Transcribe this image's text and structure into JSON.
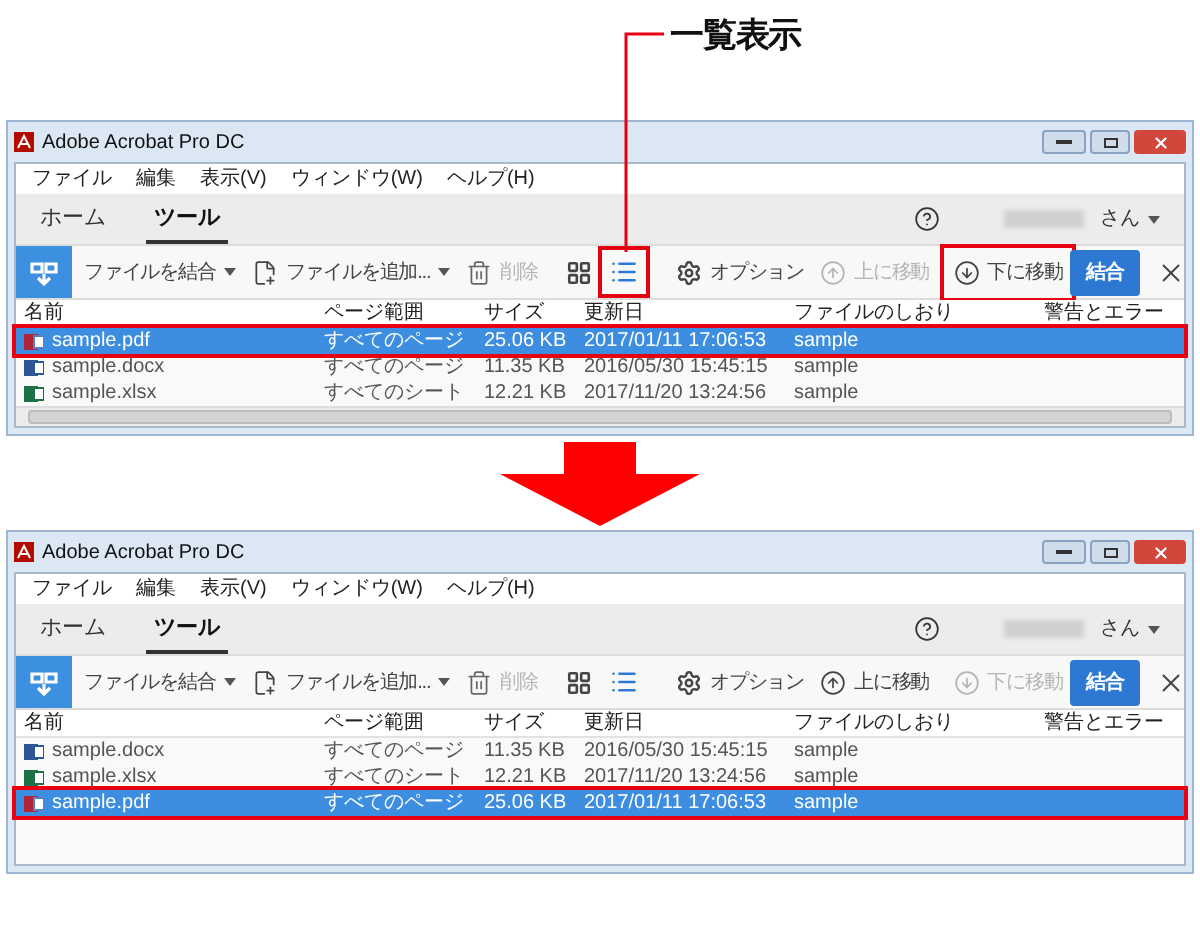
{
  "annotation": {
    "label": "一覧表示"
  },
  "windows": [
    {
      "title": "Adobe Acrobat Pro DC",
      "menu": [
        "ファイル",
        "編集",
        "表示(V)",
        "ウィンドウ(W)",
        "ヘルプ(H)"
      ],
      "tabs": [
        {
          "label": "ホーム",
          "selected": false
        },
        {
          "label": "ツール",
          "selected": true
        }
      ],
      "user_suffix": "さん",
      "toolbar": [
        {
          "kind": "start"
        },
        {
          "kind": "combine-files",
          "label": "ファイルを結合"
        },
        {
          "kind": "add-files",
          "label": "ファイルを追加..."
        },
        {
          "kind": "delete",
          "label": "削除",
          "disabled": true
        },
        {
          "kind": "grid-view",
          "selected": false
        },
        {
          "kind": "list-view",
          "selected": true,
          "highlighted": true
        },
        {
          "kind": "options",
          "label": "オプション"
        },
        {
          "kind": "move-up",
          "label": "上に移動",
          "disabled": true
        },
        {
          "kind": "move-down",
          "label": "下に移動",
          "disabled": false,
          "highlighted": true
        },
        {
          "kind": "merge",
          "label": "結合"
        },
        {
          "kind": "close"
        }
      ],
      "columns": [
        "名前",
        "ページ範囲",
        "サイズ",
        "更新日",
        "ファイルのしおり",
        "警告とエラー"
      ],
      "rows": [
        {
          "kind": "pdf",
          "cells": [
            "sample.pdf",
            "すべてのページ",
            "25.06 KB",
            "2017/01/11 17:06:53",
            "sample"
          ],
          "selected": true,
          "highlighted": true
        },
        {
          "kind": "word",
          "cells": [
            "sample.docx",
            "すべてのページ",
            "11.35 KB",
            "2016/05/30 15:45:15",
            "sample"
          ],
          "selected": false,
          "highlighted": false
        },
        {
          "kind": "excel",
          "cells": [
            "sample.xlsx",
            "すべてのシート",
            "12.21 KB",
            "2017/11/20 13:24:56",
            "sample"
          ],
          "selected": false,
          "highlighted": false
        }
      ],
      "scrollbar": true
    },
    {
      "title": "Adobe Acrobat Pro DC",
      "menu": [
        "ファイル",
        "編集",
        "表示(V)",
        "ウィンドウ(W)",
        "ヘルプ(H)"
      ],
      "tabs": [
        {
          "label": "ホーム",
          "selected": false
        },
        {
          "label": "ツール",
          "selected": true
        }
      ],
      "user_suffix": "さん",
      "toolbar": [
        {
          "kind": "start"
        },
        {
          "kind": "combine-files",
          "label": "ファイルを結合"
        },
        {
          "kind": "add-files",
          "label": "ファイルを追加..."
        },
        {
          "kind": "delete",
          "label": "削除",
          "disabled": true
        },
        {
          "kind": "grid-view",
          "selected": false
        },
        {
          "kind": "list-view",
          "selected": true
        },
        {
          "kind": "options",
          "label": "オプション"
        },
        {
          "kind": "move-up",
          "label": "上に移動",
          "disabled": false
        },
        {
          "kind": "move-down",
          "label": "下に移動",
          "disabled": true
        },
        {
          "kind": "merge",
          "label": "結合"
        },
        {
          "kind": "close"
        }
      ],
      "columns": [
        "名前",
        "ページ範囲",
        "サイズ",
        "更新日",
        "ファイルのしおり",
        "警告とエラー"
      ],
      "rows": [
        {
          "kind": "word",
          "cells": [
            "sample.docx",
            "すべてのページ",
            "11.35 KB",
            "2016/05/30 15:45:15",
            "sample"
          ],
          "selected": false,
          "highlighted": false
        },
        {
          "kind": "excel",
          "cells": [
            "sample.xlsx",
            "すべてのシート",
            "12.21 KB",
            "2017/11/20 13:24:56",
            "sample"
          ],
          "selected": false,
          "highlighted": false
        },
        {
          "kind": "pdf",
          "cells": [
            "sample.pdf",
            "すべてのページ",
            "25.06 KB",
            "2017/01/11 17:06:53",
            "sample"
          ],
          "selected": true,
          "highlighted": true
        }
      ],
      "scrollbar": false
    }
  ]
}
